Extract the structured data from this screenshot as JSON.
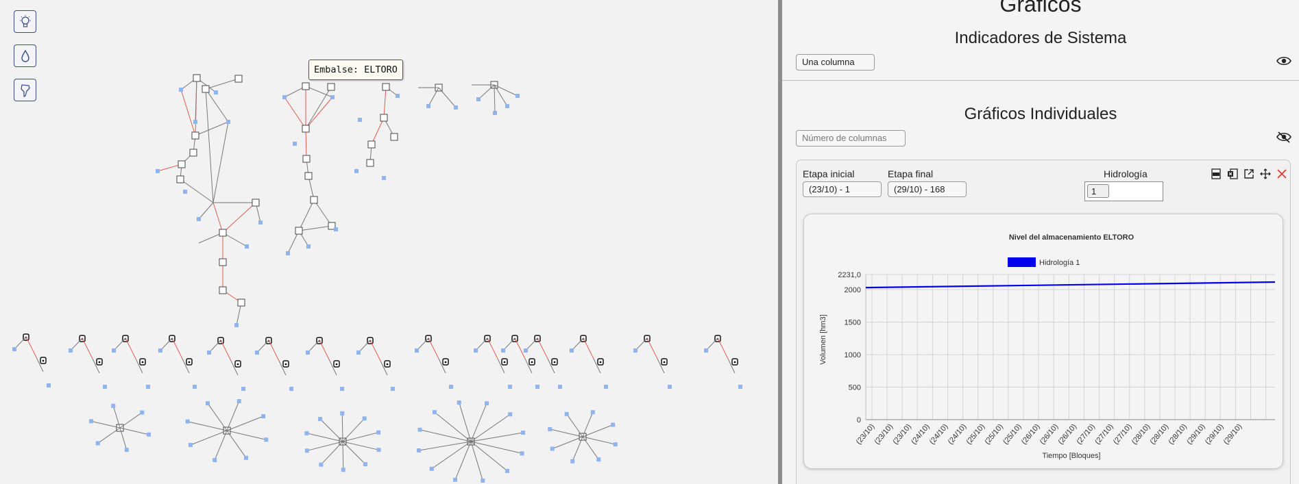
{
  "left_pane": {
    "tools": [
      {
        "name": "lightbulb-icon"
      },
      {
        "name": "drop-icon"
      },
      {
        "name": "map-outline-icon"
      }
    ],
    "tooltip": "Embalse: ELTORO"
  },
  "right_pane": {
    "header_title": "Gráficos",
    "indicators_title": "Indicadores de Sistema",
    "layout_select": "Una columna",
    "individual_title": "Gráficos Individuales",
    "columns_placeholder": "Número de columnas",
    "card": {
      "start_label": "Etapa inicial",
      "start_value": "(23/10) - 1",
      "end_label": "Etapa final",
      "end_value": "(29/10) - 168",
      "hydro_label": "Hidrología",
      "hydro_value": "1",
      "icons": [
        "csv-icon",
        "excel-icon",
        "open-external-icon",
        "move-icon",
        "close-icon"
      ]
    }
  },
  "colors": {
    "series": "#0000ee",
    "accent": "#3a4f86",
    "close": "#e53935",
    "edge_red": "#e05a4e",
    "node_blue": "#8fb4ef"
  },
  "chart_data": {
    "type": "line",
    "title": "Nivel del almacenamiento ELTORO",
    "xlabel": "Tiempo [Bloques]",
    "ylabel": "Volumen [hm3]",
    "ylim": [
      0,
      2231.0
    ],
    "ymax_label": "2231,0",
    "yticks": [
      0,
      500,
      1000,
      1500,
      2000
    ],
    "grid": true,
    "legend_position": "top-center",
    "x_categories": [
      "(23/10)",
      "(23/10)",
      "(23/10)",
      "(24/10)",
      "(24/10)",
      "(24/10)",
      "(25/10)",
      "(25/10)",
      "(25/10)",
      "(26/10)",
      "(26/10)",
      "(26/10)",
      "(27/10)",
      "(27/10)",
      "(27/10)",
      "(28/10)",
      "(28/10)",
      "(28/10)",
      "(29/10)",
      "(29/10)",
      "(29/10)"
    ],
    "series": [
      {
        "name": "Hidrología 1",
        "color": "#0000ee",
        "x": [
          1,
          168
        ],
        "y": [
          2030,
          2115
        ]
      }
    ]
  }
}
